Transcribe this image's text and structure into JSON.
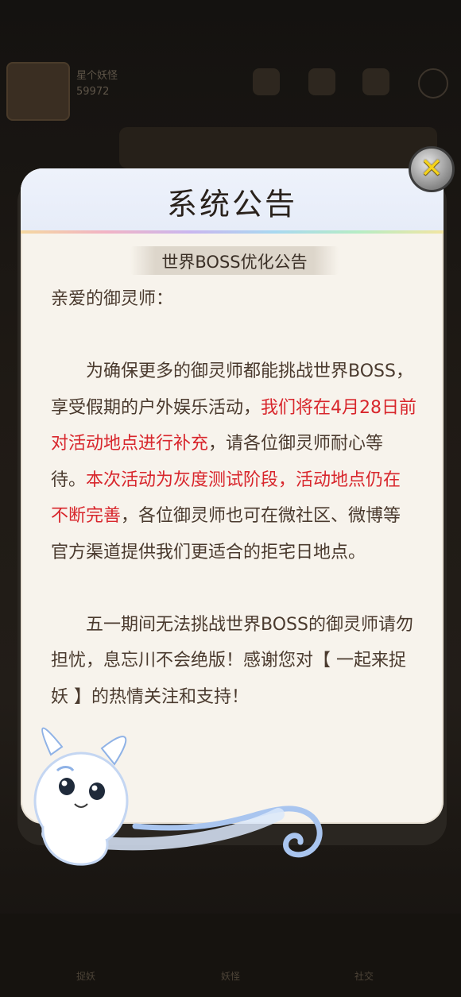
{
  "background": {
    "player_name": "星个妖怪",
    "coins": "59972",
    "nav": [
      "捉妖",
      "妖怪",
      "社交"
    ]
  },
  "dialog": {
    "title": "系统公告",
    "subtitle": "世界BOSS优化公告",
    "greeting": "亲爱的御灵师：",
    "para1_a": "为确保更多的御灵师都能挑战世界BOSS，享受假期的户外娱乐活动，",
    "para1_red1": "我们将在4月28日前对活动地点进行补充",
    "para1_b": "，请各位御灵师耐心等待。",
    "para1_red2": "本次活动为灰度测试阶段，活动地点仍在不断完善",
    "para1_c": "，各位御灵师也可在微社区、微博等官方渠道提供我们更适合的拒宅日地点。",
    "para2": "五一期间无法挑战世界BOSS的御灵师请勿担忧，息忘川不会绝版！感谢您对【 一起来捉妖 】的热情关注和支持！"
  },
  "close_icon": "close-x-icon",
  "colors": {
    "highlight": "#d8262c",
    "text": "#4a3a2e",
    "close": "#f4d21a"
  }
}
